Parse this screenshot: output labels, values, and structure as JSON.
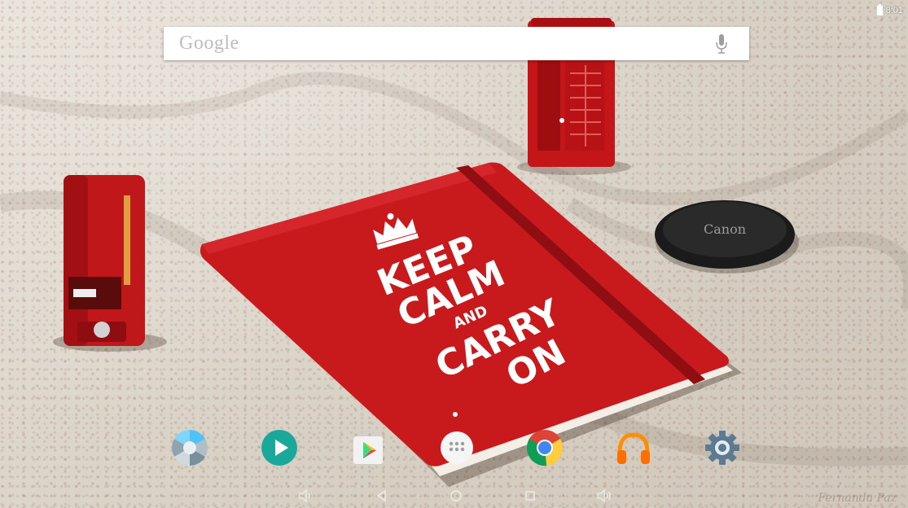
{
  "status_bar": {
    "time": "8:01"
  },
  "search": {
    "placeholder": "Google"
  },
  "wallpaper": {
    "notebook_lines": [
      "KEEP",
      "CALM",
      "AND",
      "CARRY",
      "ON"
    ],
    "lens_cap_text": "Canon",
    "signature": "Fernanda Paz",
    "accent_red": "#c8191d"
  },
  "dock": {
    "apps": [
      {
        "name": "Camera",
        "icon": "camera-shutter-icon"
      },
      {
        "name": "Play Movies",
        "icon": "play-movies-icon"
      },
      {
        "name": "Play Store",
        "icon": "play-store-icon"
      },
      {
        "name": "All apps",
        "icon": "app-drawer-icon"
      },
      {
        "name": "Chrome",
        "icon": "chrome-icon"
      },
      {
        "name": "Play Music",
        "icon": "headphones-icon"
      },
      {
        "name": "Settings",
        "icon": "gear-icon"
      }
    ]
  },
  "nav": [
    "volume-down",
    "back",
    "home",
    "recents",
    "volume-up"
  ]
}
